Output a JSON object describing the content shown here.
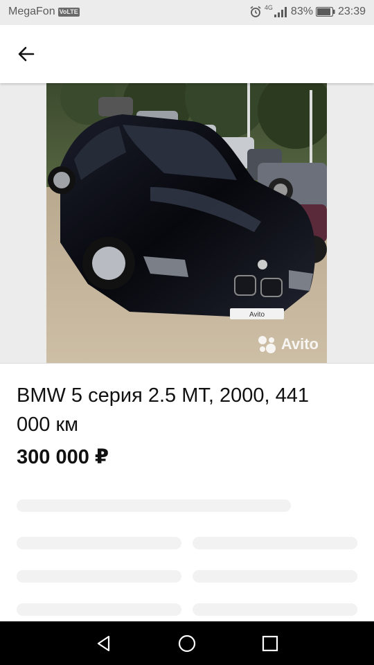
{
  "status_bar": {
    "carrier": "MegaFon",
    "volte": "VoLTE",
    "network": "4G",
    "battery": "83%",
    "time": "23:39"
  },
  "app_bar": {
    "back_icon": "arrow-left-icon"
  },
  "listing": {
    "title": "BMW 5 серия 2.5 MT, 2000, 441 000 км",
    "price": "300 000 ₽",
    "watermark": "Avito",
    "plate_text": "Avito"
  },
  "nav_bar": {
    "back_icon": "triangle-back-icon",
    "home_icon": "circle-home-icon",
    "recents_icon": "square-recents-icon"
  },
  "colors": {
    "status_bg": "#ececec",
    "gallery_bg": "#ececec",
    "skeleton": "#f2f2f2",
    "nav_bg": "#000000",
    "text": "#111111"
  }
}
